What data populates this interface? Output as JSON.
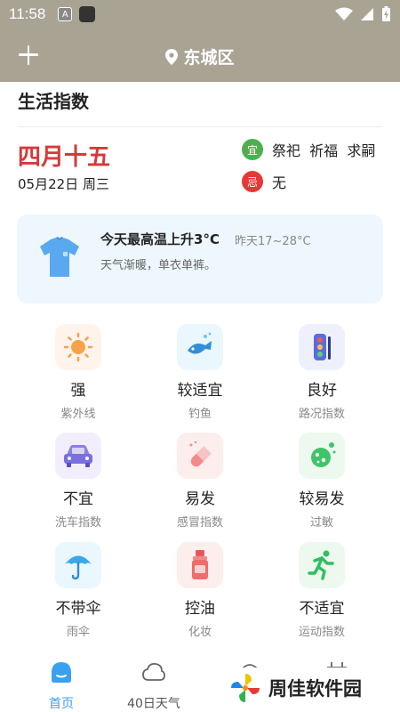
{
  "status": {
    "time": "11:58",
    "a_badge": "A"
  },
  "header": {
    "location": "东城区"
  },
  "section_title": "生活指数",
  "almanac": {
    "lunar_date": "四月十五",
    "solar_date": "05月22日 周三",
    "yi_badge": "宜",
    "yi_text": "祭祀  祈福  求嗣",
    "ji_badge": "忌",
    "ji_text": "无"
  },
  "tip": {
    "title": "今天最高温上升3°C",
    "sub": "昨天17~28°C",
    "desc": "天气渐暖，单衣单裤。"
  },
  "indices": [
    {
      "value": "强",
      "label": "紫外线",
      "icon": "sun-icon",
      "bg": "#fff4ec"
    },
    {
      "value": "较适宜",
      "label": "钓鱼",
      "icon": "fish-icon",
      "bg": "#eaf7fd"
    },
    {
      "value": "良好",
      "label": "路况指数",
      "icon": "traffic-light-icon",
      "bg": "#eef0fb"
    },
    {
      "value": "不宜",
      "label": "洗车指数",
      "icon": "car-icon",
      "bg": "#f3eefc"
    },
    {
      "value": "易发",
      "label": "感冒指数",
      "icon": "pill-icon",
      "bg": "#fdeeee"
    },
    {
      "value": "较易发",
      "label": "过敏",
      "icon": "allergy-icon",
      "bg": "#edf8ef"
    },
    {
      "value": "不带伞",
      "label": "雨伞",
      "icon": "umbrella-icon",
      "bg": "#eaf7fd"
    },
    {
      "value": "控油",
      "label": "化妆",
      "icon": "bottle-icon",
      "bg": "#fdeeee"
    },
    {
      "value": "不适宜",
      "label": "运动指数",
      "icon": "running-icon",
      "bg": "#edf8ef"
    }
  ],
  "tabs": [
    {
      "label": "首页",
      "icon": "home-icon",
      "active": true
    },
    {
      "label": "40日天气",
      "icon": "cloud-icon",
      "active": false
    }
  ],
  "watermark": {
    "text": "周佳软件园"
  },
  "colors": {
    "header_bg": "#a9a394",
    "accent": "#3aa0f0",
    "lunar_red": "#d53a3a"
  }
}
